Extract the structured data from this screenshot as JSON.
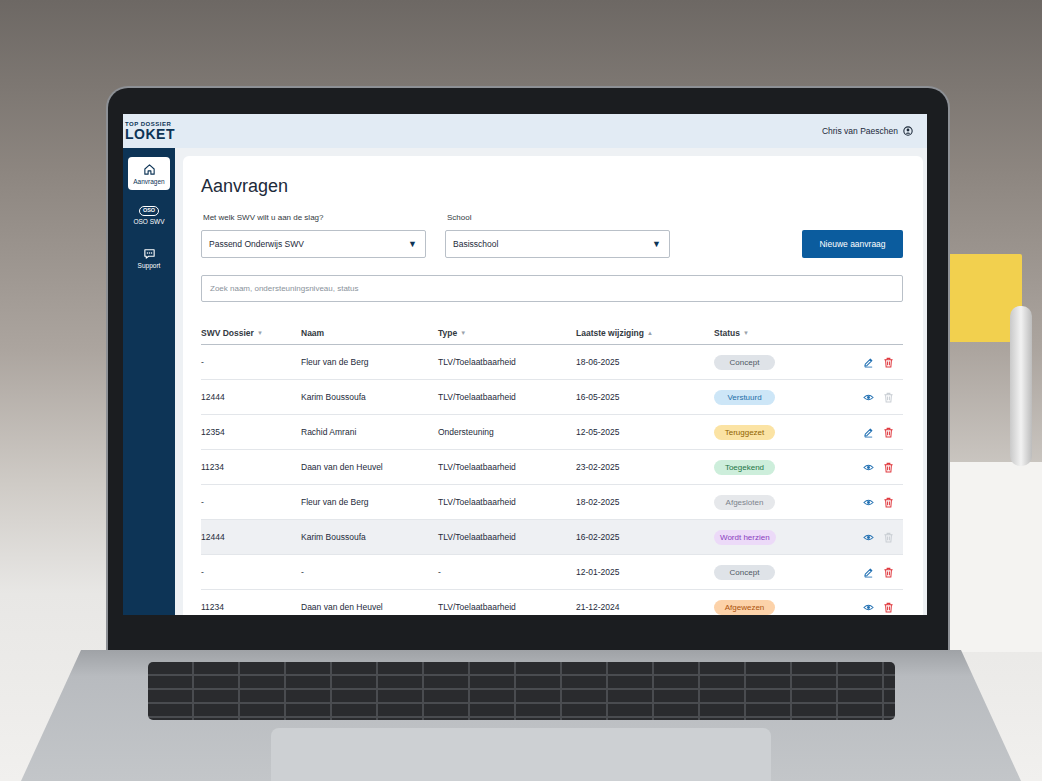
{
  "topbar": {
    "logo": {
      "tagline": "TOP DOSSIER",
      "name": "LOKET"
    },
    "user": "Chris van Paeschen"
  },
  "sidebar": {
    "items": [
      {
        "label": "Aanvragen",
        "selected": true,
        "kind": "home"
      },
      {
        "label": "OSO SWV",
        "selected": false,
        "kind": "badge",
        "badge_text": "OSO"
      },
      {
        "label": "Support",
        "selected": false,
        "kind": "chat"
      }
    ]
  },
  "page": {
    "title": "Aanvragen"
  },
  "filters": [
    {
      "label": "Met welk SWV wilt u aan de slag?",
      "value": "Passend Onderwijs SWV",
      "arrow": "▼"
    },
    {
      "label": "School",
      "value": "Basisschool",
      "arrow": "▼"
    }
  ],
  "new_button": "Nieuwe aanvraag",
  "search": {
    "placeholder": "Zoek naam, ondersteuningsniveau, status"
  },
  "table": {
    "columns": [
      {
        "label": "SWV Dossier",
        "sort": "▼"
      },
      {
        "label": "Naam"
      },
      {
        "label": "Type",
        "sort": "▼"
      },
      {
        "label": "Laatste wijziging",
        "sort": "▲"
      },
      {
        "label": "Status",
        "sort": "▼"
      }
    ],
    "rows": [
      {
        "dossier": "-",
        "name": "Fleur van de Berg",
        "type": "TLV/Toelaatbaarheid",
        "date": "18-06-2025",
        "status": "Concept",
        "color": "#dfe3e8",
        "text_color": "#4f5863",
        "kind": "edit",
        "delete_enabled": true,
        "highlighted": false
      },
      {
        "dossier": "12444",
        "name": "Karim Boussoufa",
        "type": "TLV/Toelaatbaarheid",
        "date": "16-05-2025",
        "status": "Verstuurd",
        "color": "#cde6f7",
        "text_color": "#1d6fa8",
        "kind": "view",
        "delete_enabled": false,
        "highlighted": false
      },
      {
        "dossier": "12354",
        "name": "Rachid Amrani",
        "type": "Ondersteuning",
        "date": "12-05-2025",
        "status": "Teruggezet",
        "color": "#fbe3a4",
        "text_color": "#8f6200",
        "kind": "edit",
        "delete_enabled": true,
        "highlighted": false
      },
      {
        "dossier": "11234",
        "name": "Daan van den Heuvel",
        "type": "TLV/Toelaatbaarheid",
        "date": "23-02-2025",
        "status": "Toegekend",
        "color": "#cdeedb",
        "text_color": "#1e7546",
        "kind": "view",
        "delete_enabled": true,
        "highlighted": false
      },
      {
        "dossier": "-",
        "name": "Fleur van de Berg",
        "type": "TLV/Toelaatbaarheid",
        "date": "18-02-2025",
        "status": "Afgesloten",
        "color": "#e6e8eb",
        "text_color": "#7d838b",
        "kind": "view",
        "delete_enabled": true,
        "highlighted": false
      },
      {
        "dossier": "12444",
        "name": "Karim Boussoufa",
        "type": "TLV/Toelaatbaarheid",
        "date": "16-02-2025",
        "status": "Wordt herzien",
        "color": "#ecdaf8",
        "text_color": "#8a3dc0",
        "kind": "view",
        "delete_enabled": false,
        "highlighted": true
      },
      {
        "dossier": "-",
        "name": "-",
        "type": "-",
        "date": "12-01-2025",
        "status": "Concept",
        "color": "#dfe3e8",
        "text_color": "#4f5863",
        "kind": "edit",
        "delete_enabled": true,
        "highlighted": false
      },
      {
        "dossier": "11234",
        "name": "Daan van den Heuvel",
        "type": "TLV/Toelaatbaarheid",
        "date": "21-12-2024",
        "status": "Afgewezen",
        "color": "#fcd2a9",
        "text_color": "#ad530c",
        "kind": "view",
        "delete_enabled": true,
        "highlighted": false
      }
    ]
  }
}
